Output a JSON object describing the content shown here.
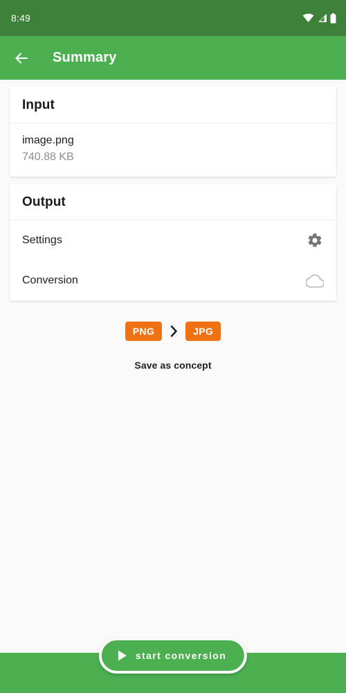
{
  "status_bar": {
    "time": "8:49",
    "icons": [
      "wifi-icon",
      "cell-signal-icon",
      "battery-icon"
    ],
    "background_color": "#3d8039"
  },
  "app_bar": {
    "back_icon": "arrow-left-icon",
    "title": "Summary",
    "background_color": "#4caf50"
  },
  "input_card": {
    "title": "Input",
    "file_name": "image.png",
    "file_size": "740.88 KB"
  },
  "output_card": {
    "title": "Output",
    "rows": [
      {
        "label": "Settings",
        "icon": "gear-icon"
      },
      {
        "label": "Conversion",
        "icon": "cloud-icon"
      }
    ]
  },
  "format": {
    "source": "PNG",
    "separator_icon": "chevron-right-icon",
    "target": "JPG",
    "badge_color": "#ef7215"
  },
  "save_concept_label": "Save as concept",
  "start_button": {
    "label": "start conversion",
    "icon": "play-icon",
    "color": "#4caf50"
  }
}
